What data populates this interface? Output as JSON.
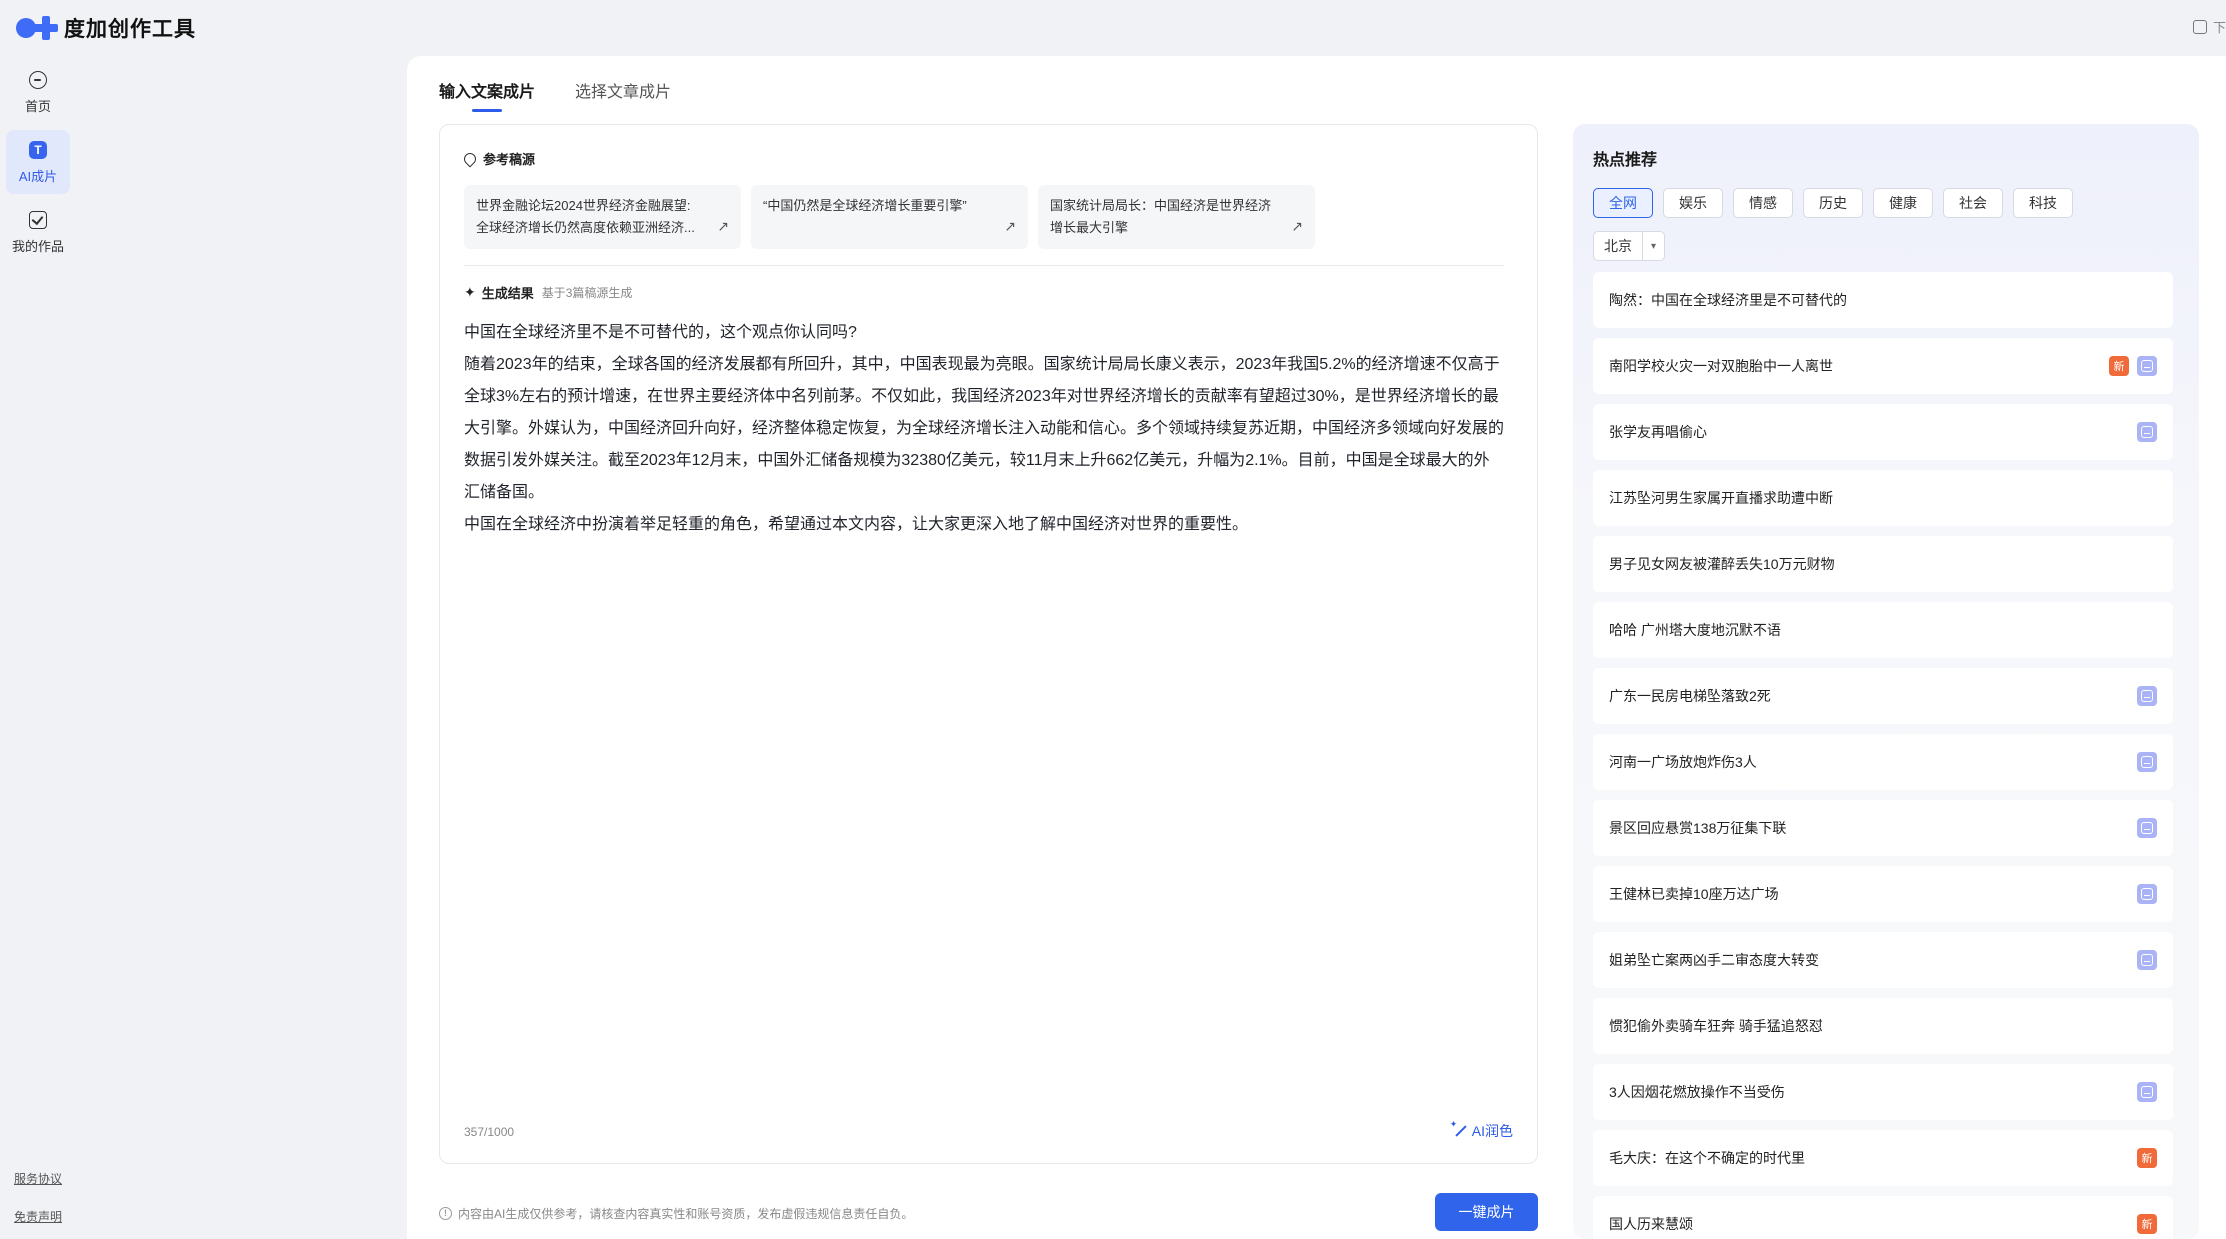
{
  "app": {
    "title": "度加创作工具",
    "top_right_label": "下"
  },
  "nav": {
    "items": [
      {
        "label": "首页",
        "icon": "home-icon"
      },
      {
        "label": "AI成片",
        "icon": "ai-icon"
      },
      {
        "label": "我的作品",
        "icon": "works-icon"
      }
    ],
    "footer": {
      "terms": "服务协议",
      "disclaimer": "免责声明"
    }
  },
  "tabs": [
    "输入文案成片",
    "选择文章成片"
  ],
  "reference": {
    "title": "参考稿源",
    "cards": [
      {
        "line1": "世界金融论坛2024世界经济金融展望:",
        "line2": "全球经济增长仍然高度依赖亚洲经济..."
      },
      {
        "line1": "“中国仍然是全球经济增长重要引擎”",
        "line2": ""
      },
      {
        "line1": "国家统计局局长：中国经济是世界经济",
        "line2": "增长最大引擎"
      }
    ]
  },
  "result": {
    "title": "生成结果",
    "subtitle": "基于3篇稿源生成",
    "paragraphs": [
      "中国在全球经济里不是不可替代的，这个观点你认同吗?",
      "随着2023年的结束，全球各国的经济发展都有所回升，其中，中国表现最为亮眼。国家统计局局长康义表示，2023年我国5.2%的经济增速不仅高于全球3%左右的预计增速，在世界主要经济体中名列前茅。不仅如此，我国经济2023年对世界经济增长的贡献率有望超过30%，是世界经济增长的最大引擎。外媒认为，中国经济回升向好，经济整体稳定恢复，为全球经济增长注入动能和信心。多个领域持续复苏近期，中国经济多领域向好发展的数据引发外媒关注。截至2023年12月末，中国外汇储备规模为32380亿美元，较11月末上升662亿美元，升幅为2.1%。目前，中国是全球最大的外汇储备国。",
      "中国在全球经济中扮演着举足轻重的角色，希望通过本文内容，让大家更深入地了解中国经济对世界的重要性。"
    ],
    "counter": "357/1000",
    "polish_label": "AI润色"
  },
  "footer": {
    "disclaimer": "内容由AI生成仅供参考，请核查内容真实性和账号资质，发布虚假违规信息责任自负。",
    "generate_button": "一键成片"
  },
  "hot": {
    "title": "热点推荐",
    "categories": [
      "全网",
      "娱乐",
      "情感",
      "历史",
      "健康",
      "社会",
      "科技"
    ],
    "region": "北京",
    "items": [
      {
        "title": "陶然：中国在全球经济里是不可替代的",
        "new": false,
        "template": false
      },
      {
        "title": "南阳学校火灾一对双胞胎中一人离世",
        "new": true,
        "template": true
      },
      {
        "title": "张学友再唱偷心",
        "new": false,
        "template": true
      },
      {
        "title": "江苏坠河男生家属开直播求助遭中断",
        "new": false,
        "template": false
      },
      {
        "title": "男子见女网友被灌醉丢失10万元财物",
        "new": false,
        "template": false
      },
      {
        "title": "哈哈 广州塔大度地沉默不语",
        "new": false,
        "template": false
      },
      {
        "title": "广东一民房电梯坠落致2死",
        "new": false,
        "template": true
      },
      {
        "title": "河南一广场放炮炸伤3人",
        "new": false,
        "template": true
      },
      {
        "title": "景区回应悬赏138万征集下联",
        "new": false,
        "template": true
      },
      {
        "title": "王健林已卖掉10座万达广场",
        "new": false,
        "template": true
      },
      {
        "title": "姐弟坠亡案两凶手二审态度大转变",
        "new": false,
        "template": true
      },
      {
        "title": "惯犯偷外卖骑车狂奔 骑手猛追怒怼",
        "new": false,
        "template": false
      },
      {
        "title": "3人因烟花燃放操作不当受伤",
        "new": false,
        "template": true
      },
      {
        "title": "毛大庆：在这个不确定的时代里",
        "new": true,
        "template": false
      },
      {
        "title": "国人历来慧颂",
        "new": true,
        "template": false
      }
    ],
    "new_badge": "新"
  },
  "colors": {
    "accent": "#3064ea",
    "new_badge": "#f06a3a",
    "template_badge": "#a9b3f6"
  }
}
